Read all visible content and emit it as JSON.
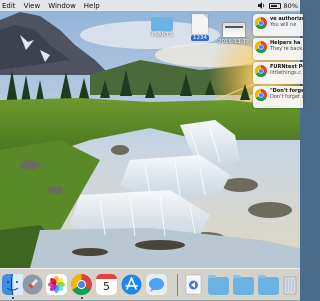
{
  "menubar": {
    "items": [
      "Edit",
      "View",
      "Window",
      "Help"
    ],
    "battery_percent": 80,
    "battery_label": "80%"
  },
  "desktop": {
    "icons": [
      {
        "label": "PLANTS",
        "type": "folder"
      },
      {
        "label": "1234",
        "type": "document"
      },
      {
        "label": "2016-11 TP",
        "type": "screenshot"
      }
    ]
  },
  "notifications": [
    {
      "app": "chrome",
      "line1": "ve authorize",
      "line2": "You will ne"
    },
    {
      "app": "chrome",
      "line1": "Helpers ha",
      "line2": "They're back"
    },
    {
      "app": "chrome",
      "line1": "FURNtext Pe",
      "line2": "littlethings.c"
    },
    {
      "app": "chrome",
      "line1": "\"Don't forget t",
      "line2": "Don't forget u"
    }
  ],
  "dock": {
    "items": [
      {
        "name": "finder",
        "icon": "finder-icon"
      },
      {
        "name": "launchpad",
        "icon": "rocket-icon"
      },
      {
        "name": "photos",
        "icon": "photos-icon"
      },
      {
        "name": "chrome",
        "icon": "chrome-icon"
      },
      {
        "name": "calendar",
        "icon": "calendar-icon",
        "day": "5"
      },
      {
        "name": "app-store",
        "icon": "appstore-icon"
      },
      {
        "name": "messages",
        "icon": "messages-icon"
      },
      {
        "name": "document",
        "icon": "document-icon"
      },
      {
        "name": "folder-1",
        "icon": "folder-icon"
      },
      {
        "name": "folder-2",
        "icon": "folder-icon"
      },
      {
        "name": "folder-3",
        "icon": "folder-icon"
      },
      {
        "name": "trash",
        "icon": "trash-icon"
      }
    ]
  },
  "colors": {
    "selection": "#2d6fd8",
    "folder": "#6cb2e2",
    "menubar": "#ebebeb"
  }
}
